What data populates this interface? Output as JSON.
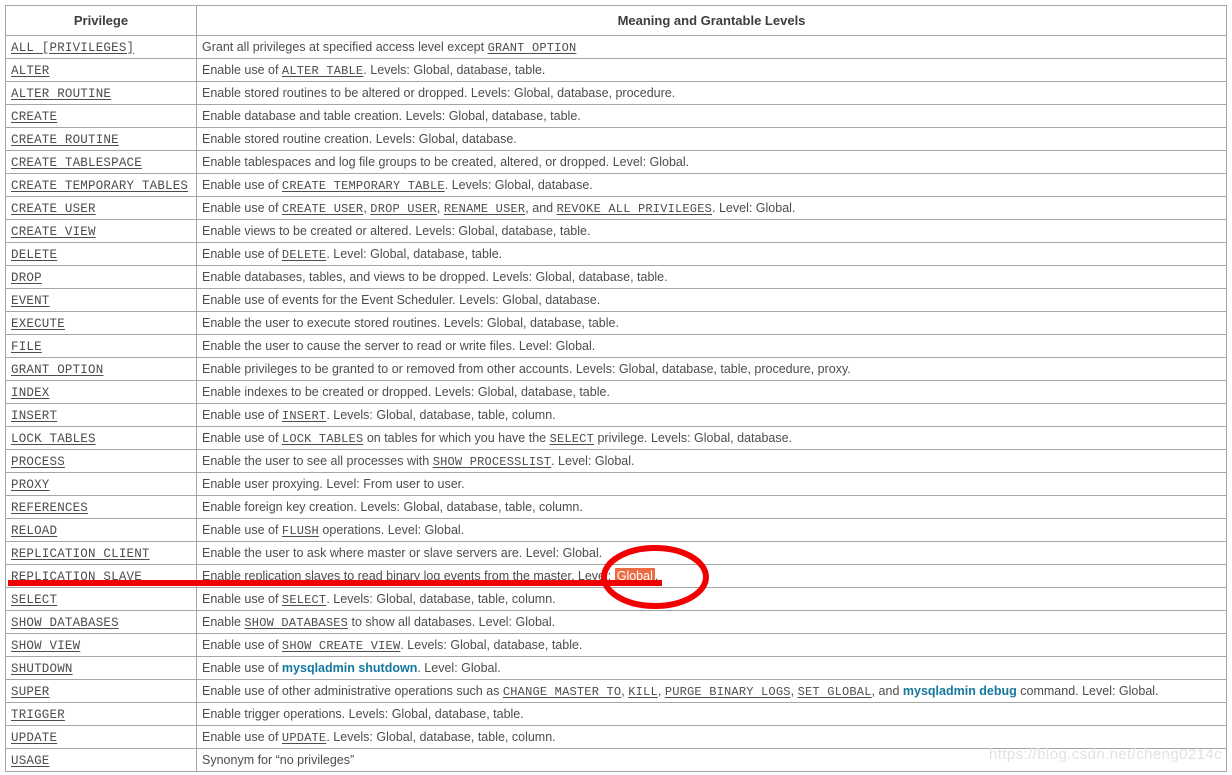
{
  "table": {
    "headers": [
      "Privilege",
      "Meaning and Grantable Levels"
    ],
    "rows": [
      {
        "privilege": "ALL [PRIVILEGES]",
        "meaning_text": "Grant all privileges at specified access level except GRANT OPTION"
      },
      {
        "privilege": "ALTER",
        "meaning_text": "Enable use of ALTER TABLE. Levels: Global, database, table."
      },
      {
        "privilege": "ALTER ROUTINE",
        "meaning_text": "Enable stored routines to be altered or dropped. Levels: Global, database, procedure."
      },
      {
        "privilege": "CREATE",
        "meaning_text": "Enable database and table creation. Levels: Global, database, table."
      },
      {
        "privilege": "CREATE ROUTINE",
        "meaning_text": "Enable stored routine creation. Levels: Global, database."
      },
      {
        "privilege": "CREATE TABLESPACE",
        "meaning_text": "Enable tablespaces and log file groups to be created, altered, or dropped. Level: Global."
      },
      {
        "privilege": "CREATE TEMPORARY TABLES",
        "meaning_text": "Enable use of CREATE TEMPORARY TABLE. Levels: Global, database."
      },
      {
        "privilege": "CREATE USER",
        "meaning_text": "Enable use of CREATE USER, DROP USER, RENAME USER, and REVOKE ALL PRIVILEGES. Level: Global."
      },
      {
        "privilege": "CREATE VIEW",
        "meaning_text": "Enable views to be created or altered. Levels: Global, database, table."
      },
      {
        "privilege": "DELETE",
        "meaning_text": "Enable use of DELETE. Level: Global, database, table."
      },
      {
        "privilege": "DROP",
        "meaning_text": "Enable databases, tables, and views to be dropped. Levels: Global, database, table."
      },
      {
        "privilege": "EVENT",
        "meaning_text": "Enable use of events for the Event Scheduler. Levels: Global, database."
      },
      {
        "privilege": "EXECUTE",
        "meaning_text": "Enable the user to execute stored routines. Levels: Global, database, table."
      },
      {
        "privilege": "FILE",
        "meaning_text": "Enable the user to cause the server to read or write files. Level: Global."
      },
      {
        "privilege": "GRANT OPTION",
        "meaning_text": "Enable privileges to be granted to or removed from other accounts. Levels: Global, database, table, procedure, proxy."
      },
      {
        "privilege": "INDEX",
        "meaning_text": "Enable indexes to be created or dropped. Levels: Global, database, table."
      },
      {
        "privilege": "INSERT",
        "meaning_text": "Enable use of INSERT. Levels: Global, database, table, column."
      },
      {
        "privilege": "LOCK TABLES",
        "meaning_text": "Enable use of LOCK TABLES on tables for which you have the SELECT privilege. Levels: Global, database."
      },
      {
        "privilege": "PROCESS",
        "meaning_text": "Enable the user to see all processes with SHOW PROCESSLIST. Level: Global."
      },
      {
        "privilege": "PROXY",
        "meaning_text": "Enable user proxying. Level: From user to user."
      },
      {
        "privilege": "REFERENCES",
        "meaning_text": "Enable foreign key creation. Levels: Global, database, table, column."
      },
      {
        "privilege": "RELOAD",
        "meaning_text": "Enable use of FLUSH operations. Level: Global."
      },
      {
        "privilege": "REPLICATION CLIENT",
        "meaning_text": "Enable the user to ask where master or slave servers are. Level: Global."
      },
      {
        "privilege": "REPLICATION SLAVE",
        "meaning_text": "Enable replication slaves to read binary log events from the master. Level: Global."
      },
      {
        "privilege": "SELECT",
        "meaning_text": "Enable use of SELECT. Levels: Global, database, table, column."
      },
      {
        "privilege": "SHOW DATABASES",
        "meaning_text": "Enable SHOW DATABASES to show all databases. Level: Global."
      },
      {
        "privilege": "SHOW VIEW",
        "meaning_text": "Enable use of SHOW CREATE VIEW. Levels: Global, database, table."
      },
      {
        "privilege": "SHUTDOWN",
        "meaning_text": "Enable use of mysqladmin shutdown. Level: Global."
      },
      {
        "privilege": "SUPER",
        "meaning_text": "Enable use of other administrative operations such as CHANGE MASTER TO, KILL, PURGE BINARY LOGS, SET GLOBAL, and mysqladmin debug command. Level: Global."
      },
      {
        "privilege": "TRIGGER",
        "meaning_text": "Enable trigger operations. Levels: Global, database, table."
      },
      {
        "privilege": "UPDATE",
        "meaning_text": "Enable use of UPDATE. Levels: Global, database, table, column."
      },
      {
        "privilege": "USAGE",
        "meaning_text": "Synonym for “no privileges”"
      }
    ]
  },
  "annotations": {
    "highlight_text": "Global",
    "highlight_color": "#ec6b41",
    "mark_color": "#f00000",
    "ellipse_target_row": "REPLICATION SLAVE",
    "underline_target_row": "REPLICATION SLAVE"
  },
  "watermark": {
    "text": "https://blog.csdn.net/cheng0214c",
    "color": "#e2e2e2"
  },
  "link_color": "#15789e"
}
